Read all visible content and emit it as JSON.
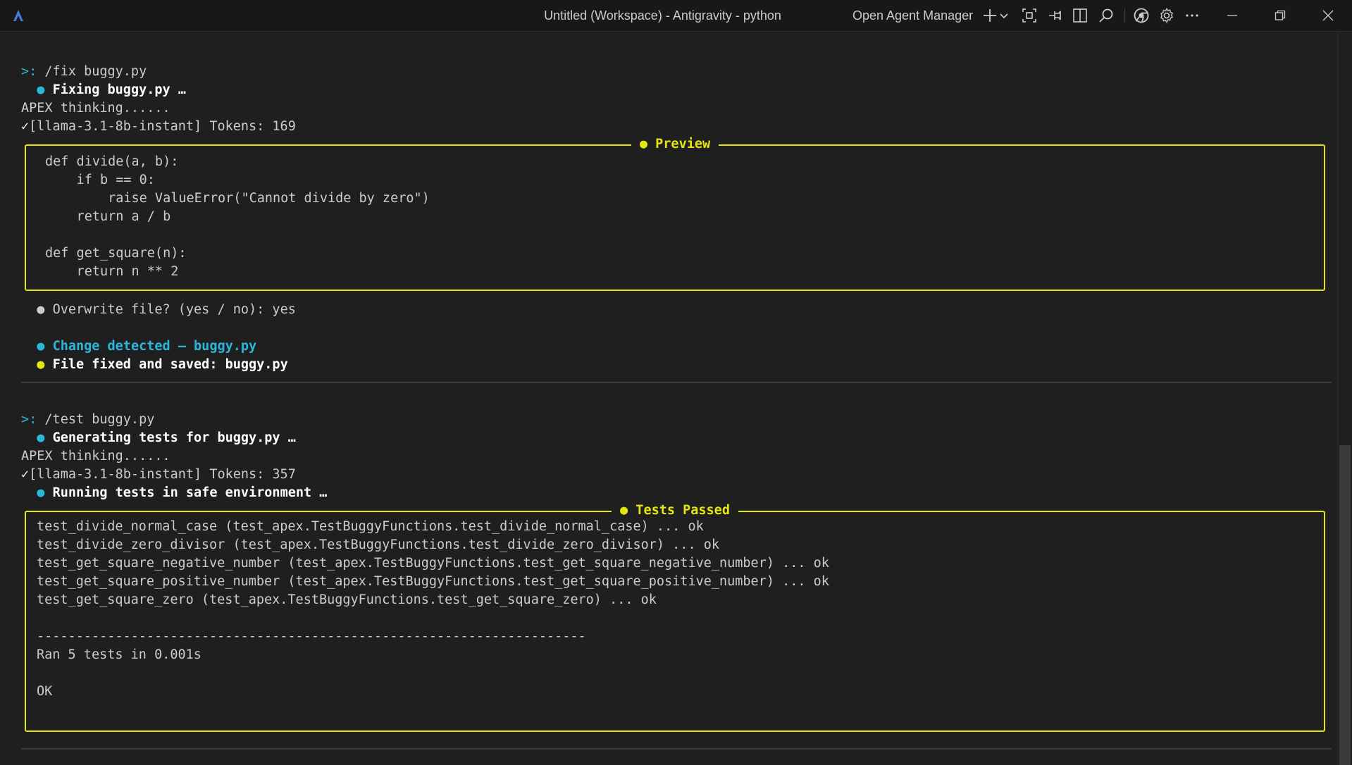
{
  "titlebar": {
    "window_title": "Untitled (Workspace) - Antigravity - python",
    "agent_manager_label": "Open Agent Manager",
    "icons": [
      "antigravity-logo",
      "plus-icon",
      "chevron-down-icon",
      "focus-icon",
      "pin-icon",
      "split-layout-icon",
      "search-icon",
      "chrome-icon",
      "gear-icon",
      "more-icon",
      "minimize-icon",
      "restore-icon",
      "close-icon"
    ]
  },
  "terminal": {
    "block1": {
      "prompt": ">:",
      "command": " /fix buggy.py",
      "status_bullet": "●",
      "status_text": "Fixing buggy.py …",
      "thinking": "APEX thinking......",
      "check": "✓",
      "model_line": "[llama-3.1-8b-instant] Tokens: 169",
      "preview_title": "● Preview",
      "code_lines": [
        "def divide(a, b):",
        "    if b == 0:",
        "        raise ValueError(\"Cannot divide by zero\")",
        "    return a / b",
        "",
        "def get_square(n):",
        "    return n ** 2"
      ],
      "overwrite_bullet": "●",
      "overwrite_text": "Overwrite file? (yes / no): yes",
      "change_bullet": "●",
      "change_text": "Change detected — buggy.py",
      "saved_bullet": "●",
      "saved_text": "File fixed and saved: buggy.py"
    },
    "block2": {
      "prompt": ">:",
      "command": " /test buggy.py",
      "status_bullet": "●",
      "status_text": "Generating tests for buggy.py …",
      "thinking": "APEX thinking......",
      "check": "✓",
      "model_line": "[llama-3.1-8b-instant] Tokens: 357",
      "running_bullet": "●",
      "running_text": "Running tests in safe environment …",
      "tests_title": "● Tests Passed",
      "test_lines": [
        "test_divide_normal_case (test_apex.TestBuggyFunctions.test_divide_normal_case) ... ok",
        "test_divide_zero_divisor (test_apex.TestBuggyFunctions.test_divide_zero_divisor) ... ok",
        "test_get_square_negative_number (test_apex.TestBuggyFunctions.test_get_square_negative_number) ... ok",
        "test_get_square_positive_number (test_apex.TestBuggyFunctions.test_get_square_positive_number) ... ok",
        "test_get_square_zero (test_apex.TestBuggyFunctions.test_get_square_zero) ... ok",
        "",
        "----------------------------------------------------------------------",
        "Ran 5 tests in 0.001s",
        "",
        "OK"
      ]
    }
  },
  "colors": {
    "accent_cyan": "#29b8db",
    "accent_yellow": "#e5e510",
    "background": "#1f1f1f",
    "titlebar": "#181818"
  }
}
